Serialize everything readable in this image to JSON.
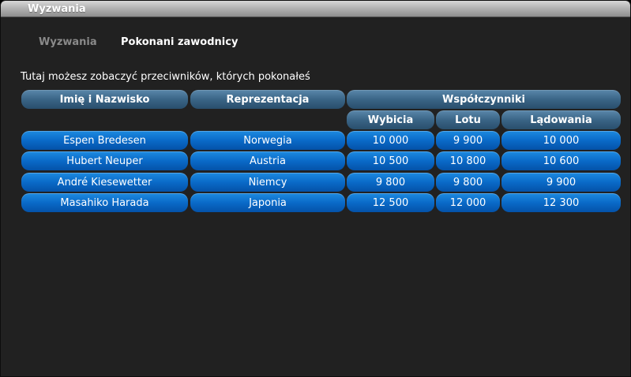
{
  "window": {
    "title": "Wyzwania"
  },
  "tabs": [
    {
      "label": "Wyzwania",
      "active": false
    },
    {
      "label": "Pokonani zawodnicy",
      "active": true
    }
  ],
  "description": "Tutaj możesz zobaczyć przeciwników, których pokonałeś",
  "table": {
    "headers": {
      "name": "Imię i Nazwisko",
      "representation": "Reprezentacja",
      "coefficients": "Współczynniki",
      "takeoff": "Wybicia",
      "flight": "Lotu",
      "landing": "Lądowania"
    },
    "rows": [
      {
        "name": "Espen Bredesen",
        "representation": "Norwegia",
        "takeoff": "10 000",
        "flight": "9 900",
        "landing": "10 000"
      },
      {
        "name": "Hubert Neuper",
        "representation": "Austria",
        "takeoff": "10 500",
        "flight": "10 800",
        "landing": "10 600"
      },
      {
        "name": "André Kiesewetter",
        "representation": "Niemcy",
        "takeoff": "9 800",
        "flight": "9 800",
        "landing": "9 900"
      },
      {
        "name": "Masahiko Harada",
        "representation": "Japonia",
        "takeoff": "12 500",
        "flight": "12 000",
        "landing": "12 300"
      }
    ]
  },
  "colors": {
    "header_blue": "#3a6586",
    "row_blue": "#0a6ac8",
    "background": "#212121"
  }
}
